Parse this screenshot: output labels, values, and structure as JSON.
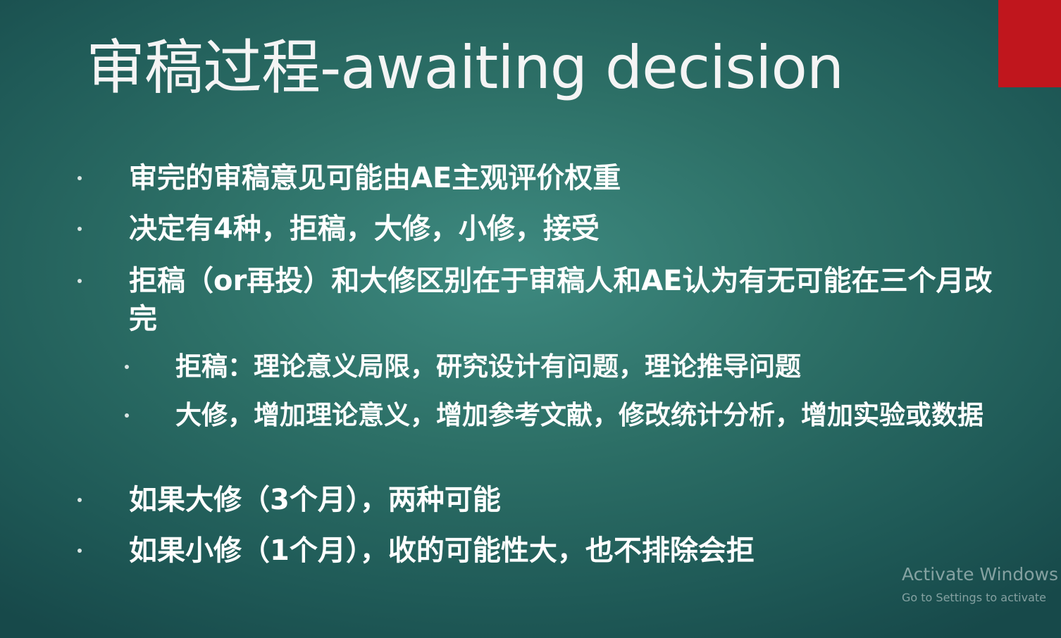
{
  "slide": {
    "title": "审稿过程-awaiting decision",
    "accent_color": "#c0161d",
    "background_color": "#2d7067",
    "bullets": [
      {
        "level": 1,
        "text": "审完的审稿意见可能由AE主观评价权重"
      },
      {
        "level": 1,
        "text": "决定有4种，拒稿，大修，小修，接受"
      },
      {
        "level": 1,
        "text": "拒稿（or再投）和大修区别在于审稿人和AE认为有无可能在三个月改完"
      },
      {
        "level": 2,
        "text": "拒稿：理论意义局限，研究设计有问题，理论推导问题"
      },
      {
        "level": 2,
        "text": "大修，增加理论意义，增加参考文献，修改统计分析，增加实验或数据"
      },
      {
        "level": 1,
        "text": "如果大修（3个月），两种可能"
      },
      {
        "level": 1,
        "text": "如果小修（1个月），收的可能性大，也不排除会拒"
      }
    ]
  },
  "watermark": {
    "title": "Activate Windows",
    "subtitle": "Go to Settings to activate"
  }
}
